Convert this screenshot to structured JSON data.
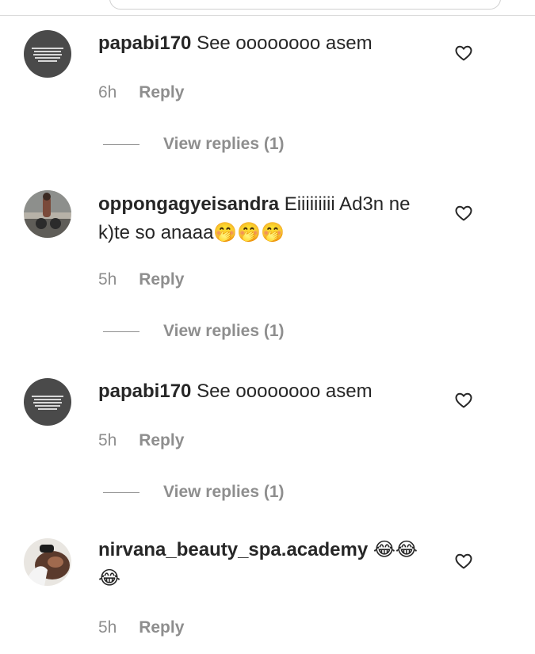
{
  "colors": {
    "text": "#262626",
    "secondary": "#8e8e8e",
    "divider": "#dbdbdb"
  },
  "comments": [
    {
      "username": "papabi170",
      "text": "See oooooooo asem",
      "time": "6h",
      "reply_label": "Reply",
      "view_replies_label": "View replies (1)",
      "avatar_icon": "text-meme-avatar",
      "like_icon": "heart-outline-icon"
    },
    {
      "username": "oppongagyeisandra",
      "text": "Eiiiiiiiii Ad3n ne k)te so anaaa🤭🤭🤭",
      "time": "5h",
      "reply_label": "Reply",
      "view_replies_label": "View replies (1)",
      "avatar_icon": "photo-avatar",
      "like_icon": "heart-outline-icon"
    },
    {
      "username": "papabi170",
      "text": "See oooooooo asem",
      "time": "5h",
      "reply_label": "Reply",
      "view_replies_label": "View replies (1)",
      "avatar_icon": "text-meme-avatar",
      "like_icon": "heart-outline-icon"
    },
    {
      "username": "nirvana_beauty_spa.academy",
      "text": "😂😂😂",
      "time": "5h",
      "reply_label": "Reply",
      "avatar_icon": "photo-avatar",
      "like_icon": "heart-outline-icon"
    }
  ]
}
